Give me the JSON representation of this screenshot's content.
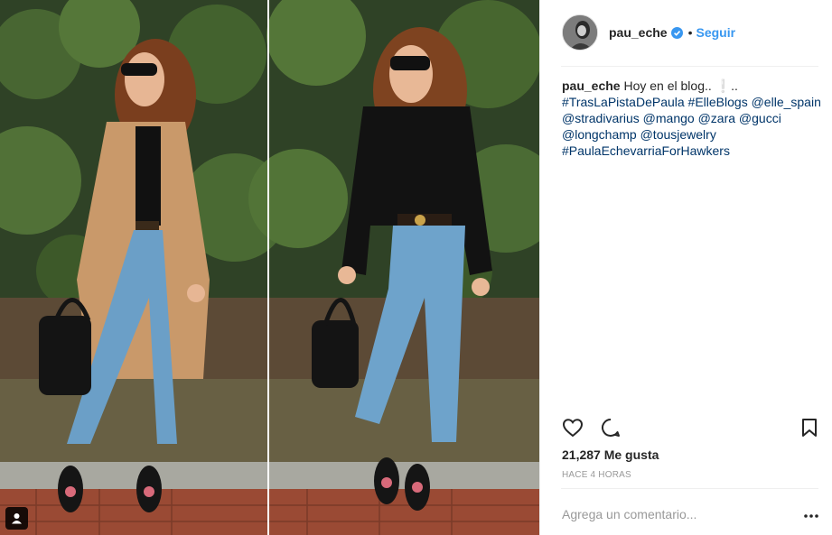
{
  "post": {
    "username": "pau_eche",
    "dot": "•",
    "follow_label": "Seguir",
    "caption": {
      "username": "pau_eche",
      "text": "Hoy en el blog..",
      "trailing": "..",
      "line2": "#TrasLaPistaDePaula #ElleBlogs @elle_spain",
      "line3": "@stradivarius @mango @zara @gucci",
      "line4": "@longchamp @tousjewelry",
      "line5": "#PaulaEchevarriaForHawkers"
    },
    "likes": "21,287 Me gusta",
    "time": "HACE 4 HORAS",
    "comment_placeholder": "Agrega un comentario...",
    "icons": {
      "like": "heart-icon",
      "comment": "comment-icon",
      "save": "bookmark-icon",
      "more": "more-options-icon",
      "verified": "verified-badge-icon",
      "tagged": "user-tag-icon"
    },
    "colors": {
      "link": "#3897f0",
      "hashtag": "#003569",
      "muted": "#999999"
    }
  }
}
